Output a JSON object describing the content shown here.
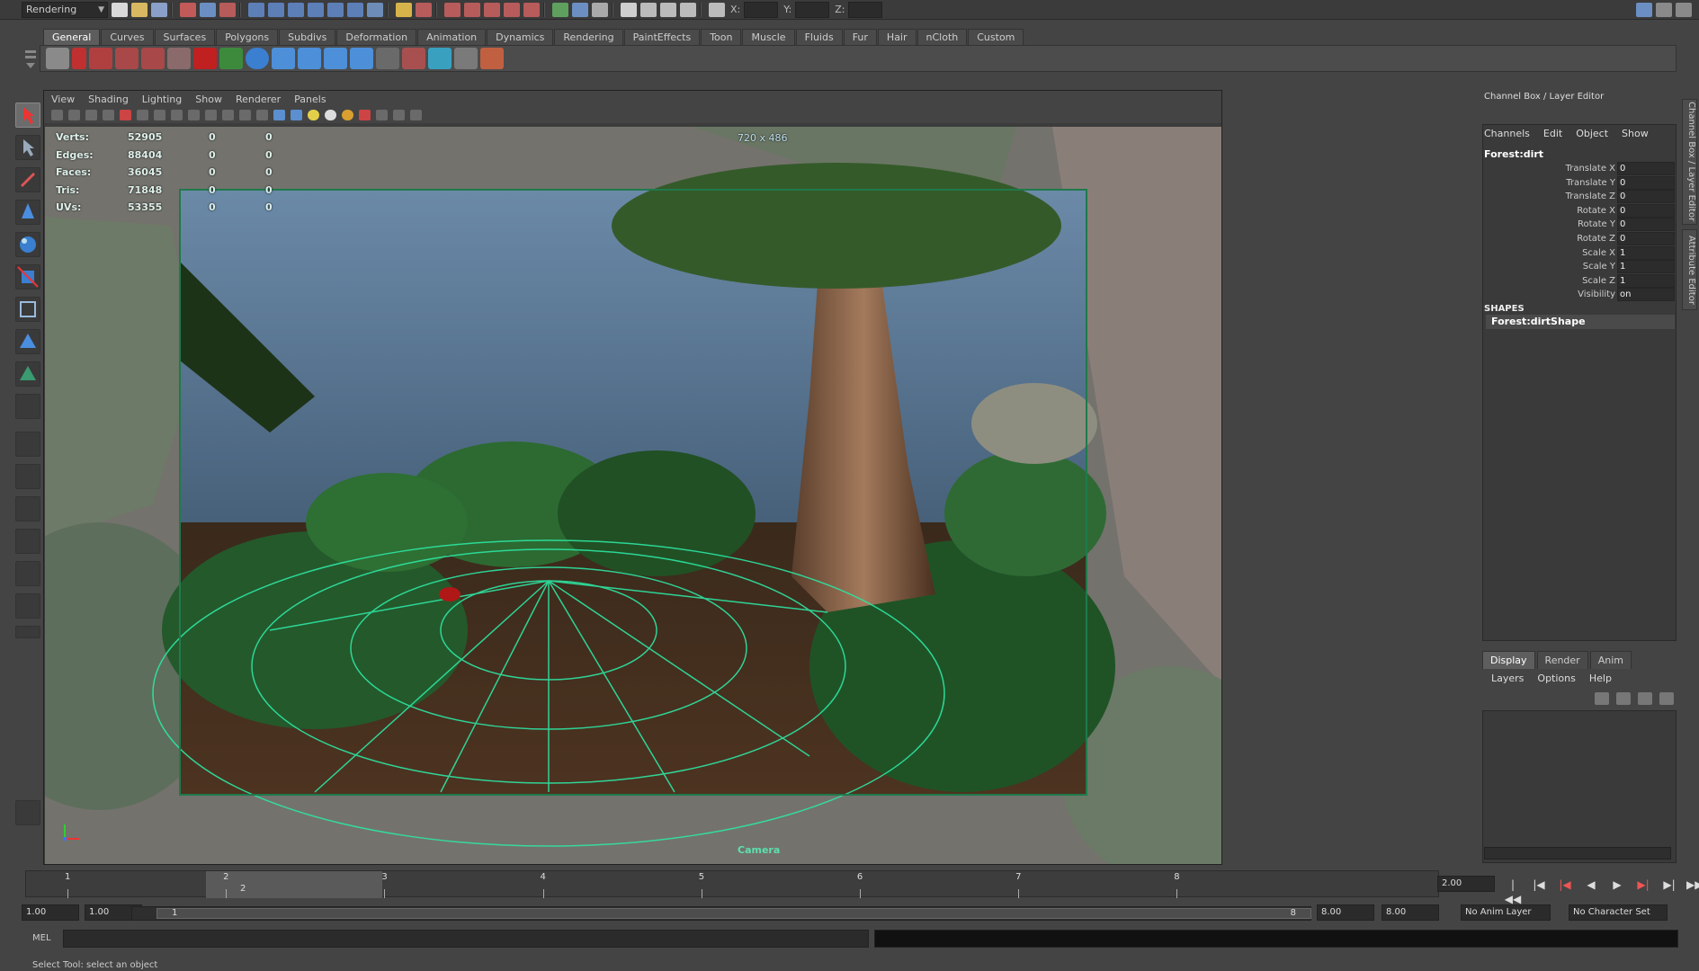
{
  "status_line": {
    "menu_set": "Rendering",
    "coords": {
      "x_label": "X:",
      "y_label": "Y:",
      "z_label": "Z:"
    }
  },
  "shelf": {
    "tabs": [
      "General",
      "Curves",
      "Surfaces",
      "Polygons",
      "Subdivs",
      "Deformation",
      "Animation",
      "Dynamics",
      "Rendering",
      "PaintEffects",
      "Toon",
      "Muscle",
      "Fluids",
      "Fur",
      "Hair",
      "nCloth",
      "Custom"
    ],
    "active_tab": "General"
  },
  "panel": {
    "menus": [
      "View",
      "Shading",
      "Lighting",
      "Show",
      "Renderer",
      "Panels"
    ],
    "resolution": "720 x 486",
    "camera_label": "Camera",
    "hud": [
      {
        "label": "Verts:",
        "v1": "52905",
        "v2": "0",
        "v3": "0"
      },
      {
        "label": "Edges:",
        "v1": "88404",
        "v2": "0",
        "v3": "0"
      },
      {
        "label": "Faces:",
        "v1": "36045",
        "v2": "0",
        "v3": "0"
      },
      {
        "label": "Tris:",
        "v1": "71848",
        "v2": "0",
        "v3": "0"
      },
      {
        "label": "UVs:",
        "v1": "53355",
        "v2": "0",
        "v3": "0"
      }
    ]
  },
  "channel_box": {
    "title": "Channel Box / Layer Editor",
    "menus": [
      "Channels",
      "Edit",
      "Object",
      "Show"
    ],
    "node": "Forest:dirt",
    "attributes": [
      {
        "name": "Translate X",
        "value": "0"
      },
      {
        "name": "Translate Y",
        "value": "0"
      },
      {
        "name": "Translate Z",
        "value": "0"
      },
      {
        "name": "Rotate X",
        "value": "0"
      },
      {
        "name": "Rotate Y",
        "value": "0"
      },
      {
        "name": "Rotate Z",
        "value": "0"
      },
      {
        "name": "Scale X",
        "value": "1"
      },
      {
        "name": "Scale Y",
        "value": "1"
      },
      {
        "name": "Scale Z",
        "value": "1"
      },
      {
        "name": "Visibility",
        "value": "on"
      }
    ],
    "shapes_label": "SHAPES",
    "shape_item": "Forest:dirtShape"
  },
  "side_tabs": [
    "Channel Box / Layer Editor",
    "Attribute Editor"
  ],
  "layer_editor": {
    "tabs": [
      "Display",
      "Render",
      "Anim"
    ],
    "active_tab": "Display",
    "menus": [
      "Layers",
      "Options",
      "Help"
    ]
  },
  "time_slider": {
    "ticks": [
      "1",
      "2",
      "3",
      "4",
      "5",
      "6",
      "7",
      "8"
    ],
    "current_marker": "2",
    "current_time": "2.00"
  },
  "range_slider": {
    "start_time": "1.00",
    "playback_start": "1.00",
    "range_start": "1",
    "range_end": "8",
    "playback_end": "8.00",
    "end_time": "8.00",
    "anim_layer": "No Anim Layer",
    "character_set": "No Character Set"
  },
  "command_line": {
    "label": "MEL"
  },
  "help_line": "Select Tool: select an object",
  "colors": {
    "wireframe": "#2de6a3",
    "panel_bg": "#444444",
    "field_bg": "#2b2b2b"
  }
}
